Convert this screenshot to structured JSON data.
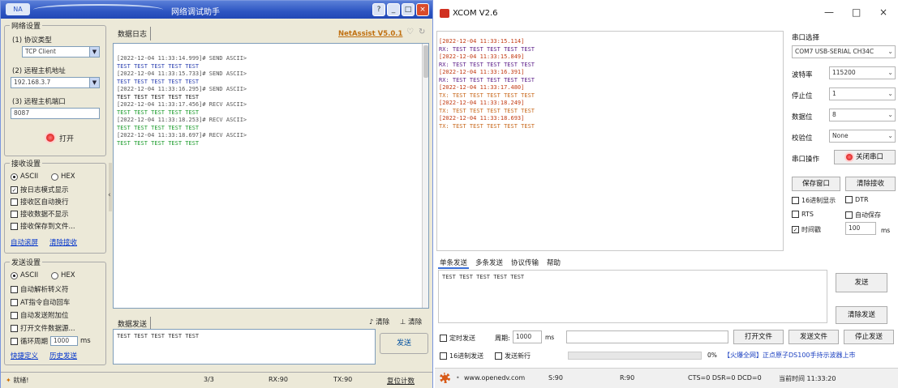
{
  "netassist": {
    "title": "网络调试助手",
    "app_icon_label": "NA",
    "window_buttons": [
      "?",
      "_",
      "□",
      "×"
    ],
    "net_settings": {
      "group_title": "网络设置",
      "protocol_label": "(1) 协议类型",
      "protocol_value": "TCP Client",
      "remote_host_label": "(2) 远程主机地址",
      "remote_host_value": "192.168.3.7",
      "remote_port_label": "(3) 远程主机端口",
      "remote_port_value": "8087",
      "open_button": "打开"
    },
    "recv_settings": {
      "group_title": "接收设置",
      "ascii": "ASCII",
      "hex": "HEX",
      "log_mode": "按日志模式显示",
      "auto_newline": "接收区自动换行",
      "hide_recv": "接收数据不显示",
      "save_to_file": "接收保存到文件...",
      "auto_scroll": "自动滚屏",
      "clear_recv": "清除接收"
    },
    "send_settings": {
      "group_title": "发送设置",
      "ascii": "ASCII",
      "hex": "HEX",
      "parse_escape": "自动解析转义符",
      "at_auto_enter": "AT指令自动回车",
      "auto_checksum": "自动发送附加位",
      "open_file": "打开文件数据源...",
      "loop_period_label": "循环周期",
      "loop_period_value": "1000",
      "loop_unit": "ms",
      "shortcut": "快捷定义",
      "history": "历史发送"
    },
    "log_tab": "数据日志",
    "brand_link": "NetAssist V5.0.1",
    "log_lines": [
      {
        "cls": "c-meta",
        "text": "[2022-12-04 11:33:14.999]# SEND ASCII>"
      },
      {
        "cls": "c-send",
        "text": "TEST  TEST  TEST  TEST  TEST"
      },
      {
        "cls": "c-meta",
        "text": "[2022-12-04 11:33:15.733]# SEND ASCII>"
      },
      {
        "cls": "c-send",
        "text": "TEST  TEST  TEST  TEST  TEST"
      },
      {
        "cls": "c-meta",
        "text": "[2022-12-04 11:33:16.295]# SEND ASCII>"
      },
      {
        "cls": "c-send2",
        "text": "TEST  TEST  TEST  TEST  TEST"
      },
      {
        "cls": "c-meta",
        "text": "[2022-12-04 11:33:17.456]# RECV ASCII>"
      },
      {
        "cls": "c-recv",
        "text": "TEST  TEST  TEST  TEST  TEST"
      },
      {
        "cls": "c-meta",
        "text": "[2022-12-04 11:33:18.253]# RECV ASCII>"
      },
      {
        "cls": "c-recv",
        "text": "TEST  TEST  TEST  TEST  TEST"
      },
      {
        "cls": "c-meta",
        "text": "[2022-12-04 11:33:18.697]# RECV ASCII>"
      },
      {
        "cls": "c-recv",
        "text": "TEST  TEST  TEST  TEST  TEST"
      }
    ],
    "send_tab": "数据发送",
    "clear_label": "清除",
    "clear_all_label": "清除",
    "send_text": "TEST  TEST  TEST  TEST  TEST",
    "send_button": "发送",
    "status": {
      "ready": "就绪!",
      "count": "3/3",
      "rx": "RX:90",
      "tx": "TX:90",
      "reset_count": "复位计数"
    }
  },
  "xcom": {
    "title": "XCOM V2.6",
    "window_buttons": [
      "—",
      "□",
      "×"
    ],
    "recv_lines": [
      {
        "cls": "xc-ts",
        "text": "[2022-12-04 11:33:15.114]"
      },
      {
        "cls": "xc-m",
        "text": "RX: TEST  TEST  TEST  TEST  TEST"
      },
      {
        "cls": "xc-ts",
        "text": "[2022-12-04 11:33:15.849]"
      },
      {
        "cls": "xc-m",
        "text": "RX: TEST  TEST  TEST  TEST  TEST"
      },
      {
        "cls": "xc-ts",
        "text": "[2022-12-04 11:33:16.391]"
      },
      {
        "cls": "xc-m",
        "text": "RX: TEST  TEST  TEST  TEST  TEST"
      },
      {
        "cls": "xc-ts",
        "text": "[2022-12-04 11:33:17.480]"
      },
      {
        "cls": "xc-t",
        "text": "TX: TEST  TEST  TEST  TEST  TEST"
      },
      {
        "cls": "xc-ts",
        "text": "[2022-12-04 11:33:18.249]"
      },
      {
        "cls": "xc-t",
        "text": "TX: TEST  TEST  TEST  TEST  TEST"
      },
      {
        "cls": "xc-ts",
        "text": "[2022-12-04 11:33:18.693]"
      },
      {
        "cls": "xc-t",
        "text": "TX: TEST  TEST  TEST  TEST  TEST"
      }
    ],
    "side": {
      "port_select_label": "串口选择",
      "port_value": "COM7 USB-SERIAL CH34C",
      "baud_label": "波特率",
      "baud_value": "115200",
      "stop_label": "停止位",
      "stop_value": "1",
      "data_label": "数据位",
      "data_value": "8",
      "parity_label": "校验位",
      "parity_value": "None",
      "port_op_label": "串口操作",
      "close_port": "关闭串口",
      "save_window": "保存窗口",
      "clear_recv": "清除接收",
      "hex_display": "16进制显示",
      "dtr": "DTR",
      "rts": "RTS",
      "auto_save": "自动保存",
      "timestamp": "时间戳",
      "timestamp_value": "100",
      "timestamp_unit": "ms"
    },
    "tabs": [
      "单条发送",
      "多条发送",
      "协议传输",
      "帮助"
    ],
    "send_text": "TEST  TEST  TEST  TEST  TEST",
    "send_button": "发送",
    "clear_send": "清除发送",
    "timed_send": "定时发送",
    "period_label": "周期:",
    "period_value": "1000",
    "period_unit": "ms",
    "open_file": "打开文件",
    "send_file": "发送文件",
    "stop_send": "停止发送",
    "hex_send": "16进制发送",
    "send_newline": "发送新行",
    "progress_pct": "0%",
    "promo": "【火爆全网】正点原子DS100手持示波器上市",
    "status": {
      "url": "www.openedv.com",
      "sent": "S:90",
      "recv": "R:90",
      "lines": "CTS=0 DSR=0 DCD=0",
      "time": "当前时间 11:33:20"
    }
  }
}
